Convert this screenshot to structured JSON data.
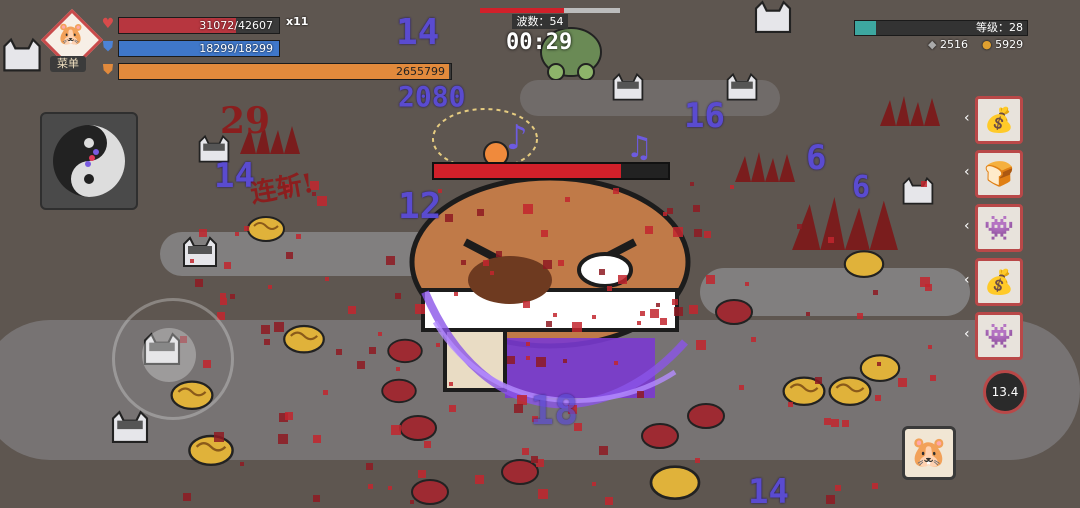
{
  "hud": {
    "menu_label": "菜单",
    "hp_text": "31072/42607",
    "hp_fraction": 0.73,
    "shield_text": "18299/18299",
    "shield_fraction": 1.0,
    "xp_text": "2655799",
    "xp_fraction": 0.995,
    "multiplier_text": "x11"
  },
  "wave": {
    "label": "波数：54",
    "timer": "00:29"
  },
  "level": {
    "label": "等级：28",
    "progress": 0.12
  },
  "resources": {
    "gems": "2516",
    "coins": "5929"
  },
  "skills": [
    {
      "name": "gold-pile-skill",
      "glyph": "💰"
    },
    {
      "name": "bun-skill",
      "glyph": "🍞"
    },
    {
      "name": "purple-spirit-skill",
      "glyph": "👾"
    },
    {
      "name": "gold-pile-skill-2",
      "glyph": "💰"
    },
    {
      "name": "purple-spirit-skill-2",
      "glyph": "👾"
    }
  ],
  "cooldown_text": "13.4",
  "combat_text": {
    "red_hit": "29",
    "slash": "连斩!",
    "numbers": [
      "14",
      "12",
      "16",
      "6",
      "6",
      "14",
      "14",
      "18",
      "2080"
    ]
  },
  "boss_hp_fraction": 0.8,
  "colors": {
    "hp": "#b7363f",
    "shield": "#3f77c9",
    "xp": "#e28a3c",
    "accent": "#b94848"
  }
}
